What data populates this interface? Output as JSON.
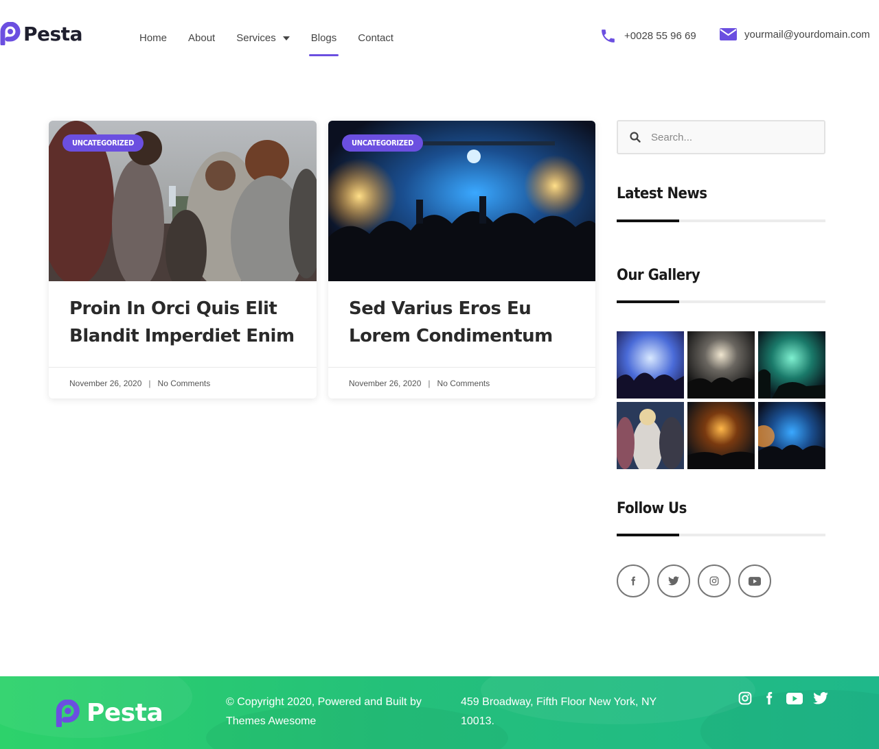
{
  "header": {
    "logo_text": "Pesta",
    "nav": [
      {
        "label": "Home"
      },
      {
        "label": "About"
      },
      {
        "label": "Services"
      },
      {
        "label": "Blogs"
      },
      {
        "label": "Contact"
      }
    ],
    "active_nav": "Blogs",
    "phone": "+0028 55 96 69",
    "email": "yourmail@yourdomain.com"
  },
  "posts": [
    {
      "category": "UNCATEGORIZED",
      "title": "Proin In Orci Quis Elit Blandit Imperdiet Enim",
      "date": "November 26, 2020",
      "separator": "|",
      "comments": "No Comments"
    },
    {
      "category": "UNCATEGORIZED",
      "title": "Sed Varius Eros Eu Lorem Condimentum",
      "date": "November 26, 2020",
      "separator": "|",
      "comments": "No Comments"
    }
  ],
  "sidebar": {
    "search_placeholder": "Search...",
    "latest_news_title": "Latest News",
    "gallery_title": "Our Gallery",
    "follow_title": "Follow Us",
    "social": [
      "facebook-icon",
      "twitter-icon",
      "instagram-icon",
      "youtube-icon"
    ]
  },
  "footer": {
    "logo_text": "Pesta",
    "copyright": "© Copyright 2020, Powered and Built by Themes Awesome",
    "address": "459 Broadway, Fifth Floor New York, NY 10013.",
    "social": [
      "instagram-icon",
      "facebook-icon",
      "youtube-icon",
      "twitter-icon"
    ]
  },
  "colors": {
    "accent": "#6b4fe0",
    "footer_gradient_start": "#2dd26b",
    "footer_gradient_end": "#1fb88a",
    "text_dark": "#1a1a1a"
  }
}
